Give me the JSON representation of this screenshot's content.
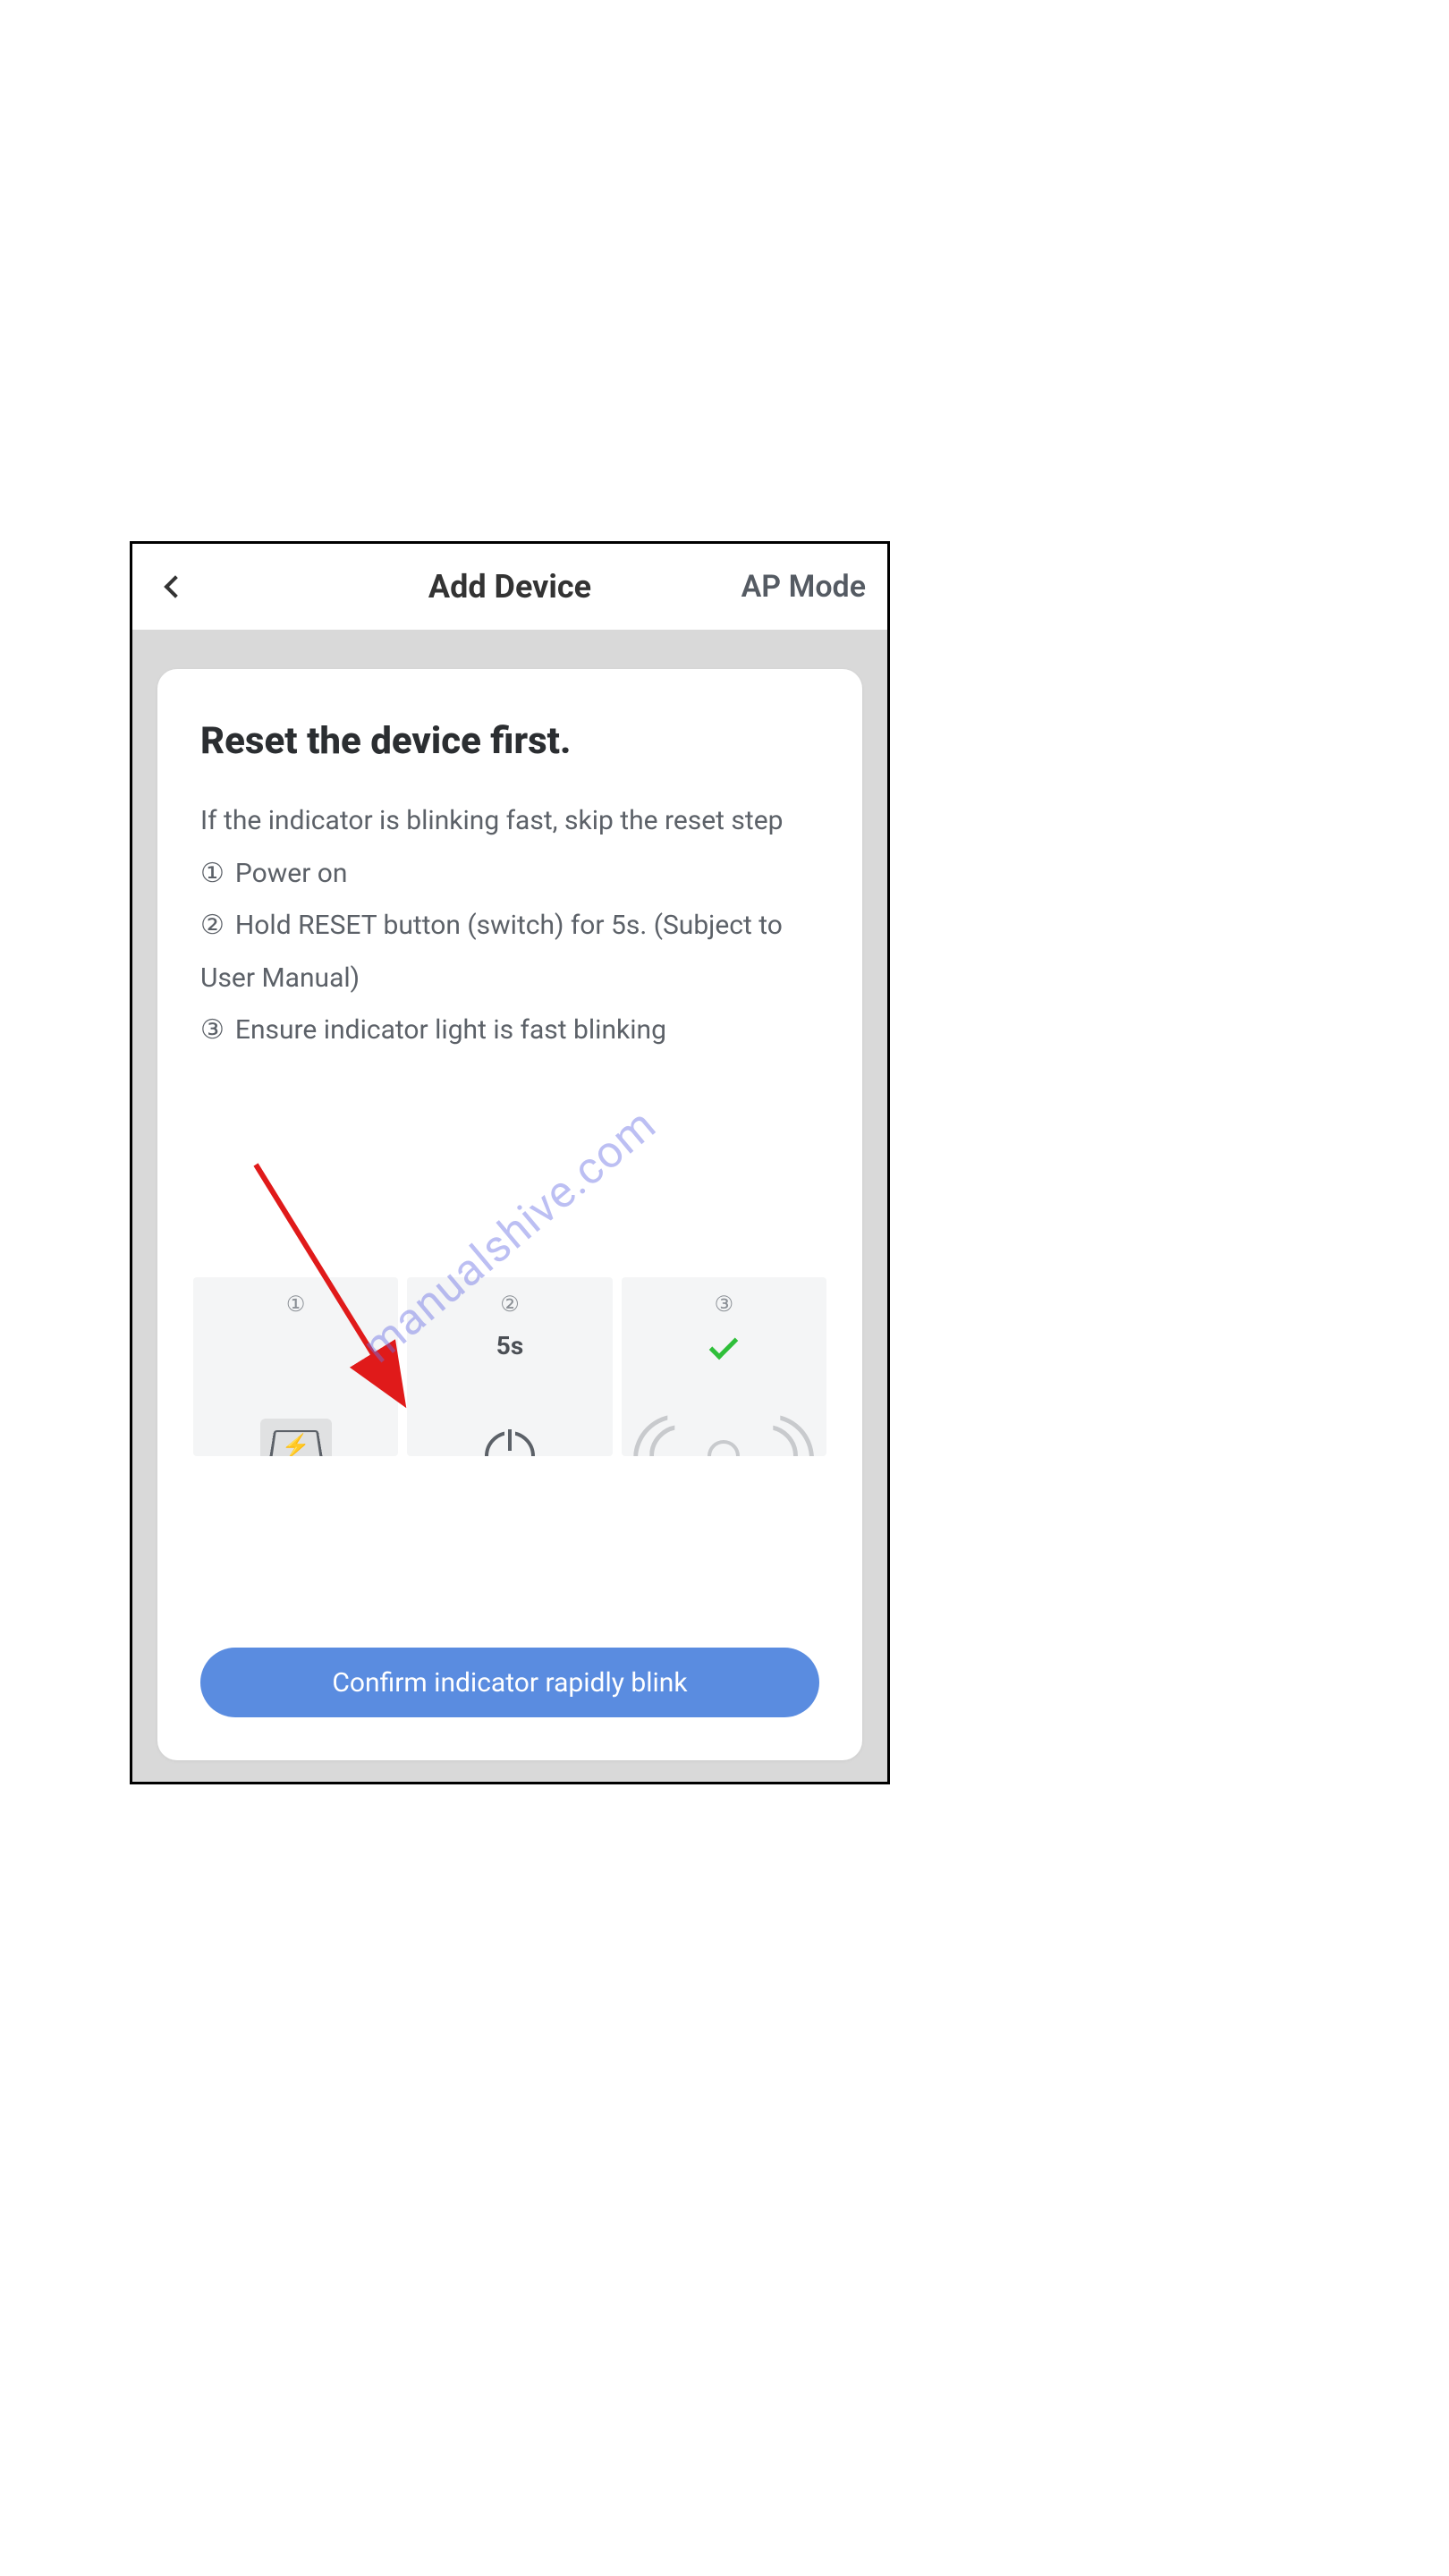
{
  "header": {
    "title": "Add Device",
    "mode_link": "AP Mode"
  },
  "card": {
    "title": "Reset the device first.",
    "intro": "If the indicator is blinking fast, skip the reset step",
    "steps": {
      "s1": "Power on",
      "s2": "Hold RESET button (switch) for 5s. (Subject to User Manual)",
      "s3": "Ensure indicator light is fast blinking"
    },
    "step_nums": {
      "n1": "①",
      "n2": "②",
      "n3": "③"
    },
    "tiles": {
      "t1_num": "①",
      "t2_num": "②",
      "t2_label": "5s",
      "t3_num": "③"
    }
  },
  "confirm_button": "Confirm indicator rapidly blink",
  "watermark": "manualshive.com"
}
